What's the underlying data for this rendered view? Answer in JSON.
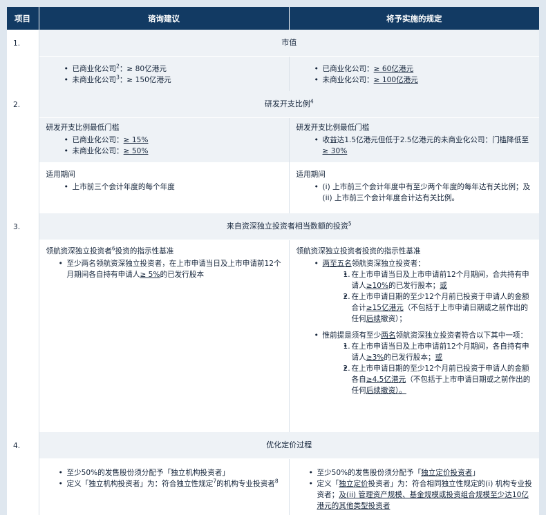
{
  "header": {
    "col_item": "项目",
    "col_consult": "谘询建议",
    "col_final": "将予实施的规定"
  },
  "s1": {
    "num": "1.",
    "title": "市值",
    "left": {
      "b1_pre": "已商业化公司",
      "b1_sup": "2",
      "b1_post": "：≥ 80亿港元",
      "b2_pre": "未商业化公司",
      "b2_sup": "3",
      "b2_post": "：≥ 150亿港元"
    },
    "right": {
      "b1_pre": "已商业化公司：",
      "b1_u": "≥ 60亿港元",
      "b2_pre": "未商业化公司：",
      "b2_u": "≥ 100亿港元"
    }
  },
  "s2": {
    "num": "2.",
    "title": "研发开支比例",
    "title_sup": "4",
    "left_a": {
      "heading": "研发开支比例最低门槛",
      "b1_pre": "已商业化公司：",
      "b1_u": "≥ 15%",
      "b2_pre": "未商业化公司：",
      "b2_u": "≥ 50%"
    },
    "right_a": {
      "heading": "研发开支比例最低门槛",
      "b1": "收益达1.5亿港元但低于2.5亿港元的未商业化公司：门槛降低至",
      "b1_u": "≥ 30%"
    },
    "left_b": {
      "heading": "适用期间",
      "b1": "上市前三个会计年度的每个年度"
    },
    "right_b": {
      "heading": "适用期间",
      "b1": "(i) 上市前三个会计年度中有至少两个年度的每年达有关比例；及 (ii) 上市前三个会计年度合计达有关比例。"
    }
  },
  "s3": {
    "num": "3.",
    "title": "来自资深独立投资者相当数额的投资",
    "title_sup": "5",
    "left": {
      "heading_pre": "领航资深独立投资者",
      "heading_sup": "6",
      "heading_post": "投资的指示性基准",
      "b1_pre": "至少两名领航资深独立投资者，在上市申请当日及上市申请前12个月期间各自持有申请人",
      "b1_u": "≥ 5%",
      "b1_post": "的已发行股本"
    },
    "right": {
      "heading": "领航资深独立投资者投资的指示性基准",
      "b1_u": "两至五名",
      "b1_post": "领航资深独立投资者：",
      "b1_i1_num": "1.",
      "b1_i1_pre": "在上市申请当日及上市申请前12个月期间，合共持有申请人",
      "b1_i1_u": "≥10%",
      "b1_i1_mid": "的已发行股本；",
      "b1_i1_u2": "或",
      "b1_i2_num": "2.",
      "b1_i2_pre": "在上市申请日期的至少12个月前已投资于申请人的金额合计",
      "b1_i2_u": "≥15亿港元",
      "b1_i2_mid": "（不包括于上市申请日期或之前作出的任何",
      "b1_i2_u2": "后续",
      "b1_i2_post": "撤资）；",
      "b2_pre": "惟前提是须有至少",
      "b2_u": "两名",
      "b2_post": "领航资深独立投资者符合以下其中一项：",
      "b2_i1_num": "1.",
      "b2_i1_pre": "在上市申请当日及上市申请前12个月期间，各自持有申请人",
      "b2_i1_u": "≥3%",
      "b2_i1_mid": "的已发行股本；",
      "b2_i1_u2": "或",
      "b2_i2_num": "2.",
      "b2_i2_pre": "在上市申请日期的至少12个月前已投资于申请人的金额各自",
      "b2_i2_u": "≥4.5亿港元",
      "b2_i2_mid": "（不包括于上市申请日期或之前作出的任何",
      "b2_i2_u2": "后续撤资）。"
    }
  },
  "s4": {
    "num": "4.",
    "title": "优化定价过程",
    "left": {
      "b1": "至少50%的发售股份须分配予「独立机构投资者」",
      "b2_pre": "定义「独立机构投资者」为：符合独立性规定",
      "b2_sup": "7",
      "b2_post": "的机构专业投资者",
      "b2_sup2": "8"
    },
    "right": {
      "b1_pre": "至少50%的发售股份须分配予「",
      "b1_u": "独立定价投资者",
      "b1_post": "」",
      "b2_pre": "定义「",
      "b2_u": "独立定价",
      "b2_mid": "投资者」为：符合相同独立性规定的(i) 机构专业投资者；",
      "b2_u2": "及(ii) 管理资产规模、基金规模或投资组合规模至少达10亿港元的其他类型投资者"
    }
  }
}
